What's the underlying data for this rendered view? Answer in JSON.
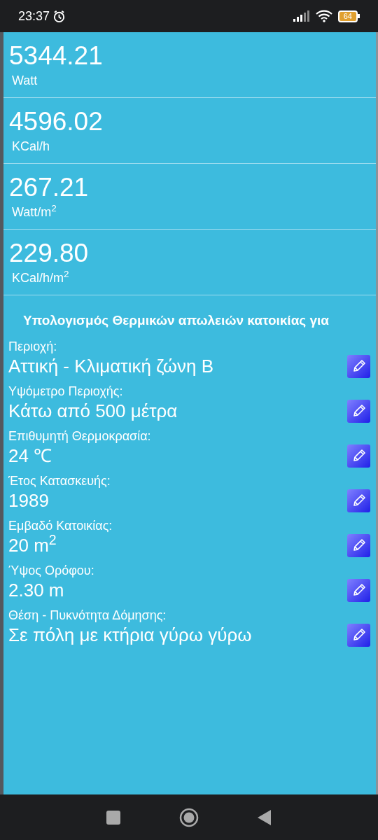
{
  "status_bar": {
    "time": "23:37",
    "battery": "64"
  },
  "results": [
    {
      "value": "5344.21",
      "unit": "Watt"
    },
    {
      "value": "4596.02",
      "unit": "KCal/h"
    },
    {
      "value": "267.21",
      "unit": "Watt/m$^{2}$"
    },
    {
      "value": "229.80",
      "unit": "KCal/h/m$^{2}$"
    }
  ],
  "section_title": "Υπολογισμός Θερμικών απωλειών κατοικίας για",
  "fields": [
    {
      "label": "Περιοχή:",
      "value": "Αττική - Κλιματική ζώνη Β"
    },
    {
      "label": "Υψόμετρο Περιοχής:",
      "value": "Κάτω από 500 μέτρα"
    },
    {
      "label": "Επιθυμητή Θερμοκρασία:",
      "value": "24 ℃"
    },
    {
      "label": "Έτος Κατασκευής:",
      "value": "1989"
    },
    {
      "label": "Εμβαδό Κατοικίας:",
      "value": "20 m$^{2}$"
    },
    {
      "label": "Ύψος Ορόφου:",
      "value": "2.30 m"
    },
    {
      "label": "Θέση - Πυκνότητα Δόμησης:",
      "value": "Σε πόλη με κτήρια γύρω γύρω"
    }
  ]
}
